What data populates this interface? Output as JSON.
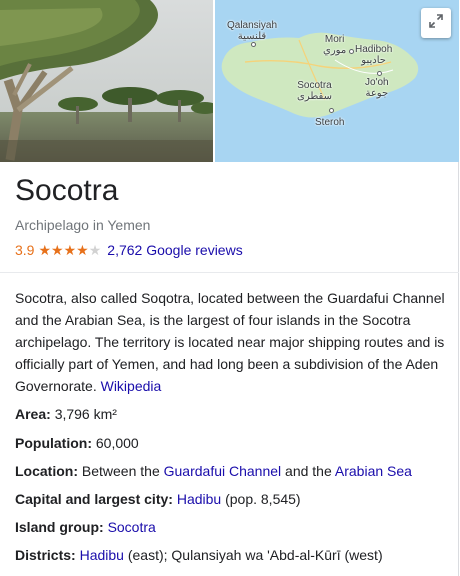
{
  "title": "Socotra",
  "subtitle": "Archipelago in Yemen",
  "rating": {
    "value": "3.9",
    "stars_filled": 4,
    "stars_total": 5,
    "reviews_text": "2,762 Google reviews"
  },
  "map": {
    "labels": {
      "qalansiyah": "Qalansiyah",
      "qalansiyah_ar": "قلنسية",
      "mori": "Mori",
      "mori_ar": "موري",
      "hadiboh": "Hadiboh",
      "hadiboh_ar": "حاديبو",
      "socotra": "Socotra",
      "socotra_ar": "سقطرى",
      "jooh": "Jo'oh",
      "jooh_ar": "جوعة",
      "steroh": "Steroh"
    },
    "land_color": "#cfe8c0",
    "water_color": "#a8d5f2"
  },
  "description": {
    "text": "Socotra, also called Soqotra, located between the Guardafui Channel and the Arabian Sea, is the largest of four islands in the Socotra archipelago. The territory is located near major shipping routes and is officially part of Yemen, and had long been a subdivision of the Aden Governorate.",
    "source_link": "Wikipedia"
  },
  "facts": {
    "area": {
      "label": "Area:",
      "value": "3,796 km²"
    },
    "population": {
      "label": "Population:",
      "value": "60,000"
    },
    "location": {
      "label": "Location:",
      "prefix": "Between the",
      "link1": "Guardafui Channel",
      "middle": "and the",
      "link2": "Arabian Sea"
    },
    "capital": {
      "label": "Capital and largest city:",
      "link": "Hadibu",
      "suffix": "(pop. 8,545)"
    },
    "island_group": {
      "label": "Island group:",
      "link": "Socotra"
    },
    "districts": {
      "label": "Districts:",
      "link": "Hadibu",
      "suffix": "(east); Qulansiyah wa 'Abd-al-Kūrī (west)"
    }
  },
  "colors": {
    "link": "#1a0dab",
    "rating_orange": "#e7711b",
    "secondary_text": "#70757a"
  }
}
